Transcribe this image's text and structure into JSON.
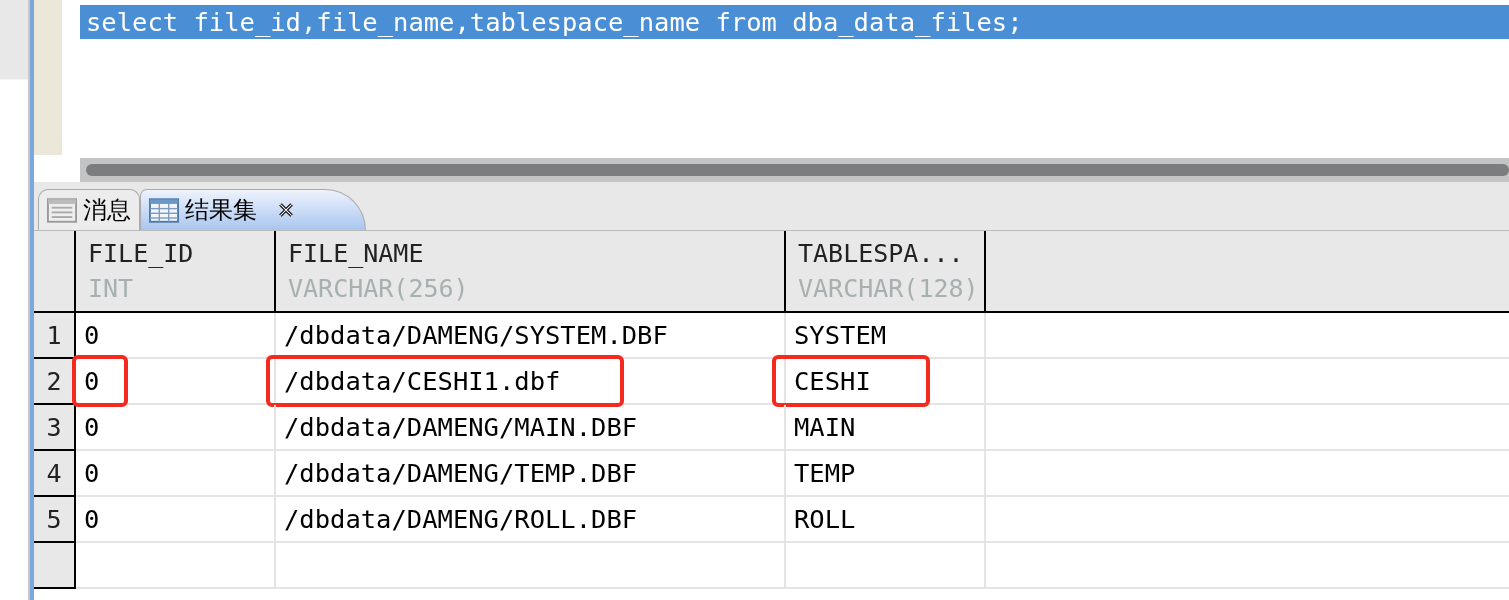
{
  "editor": {
    "query": "select file_id,file_name,tablespace_name from dba_data_files;",
    "selected": true
  },
  "tabs": [
    {
      "label": "消息",
      "selected": false,
      "closable": false
    },
    {
      "label": "结果集",
      "selected": true,
      "closable": true
    }
  ],
  "table": {
    "columns": [
      {
        "name": "FILE_ID",
        "type": "INT"
      },
      {
        "name": "FILE_NAME",
        "type": "VARCHAR(256)"
      },
      {
        "name": "TABLESPA...",
        "type": "VARCHAR(128)"
      }
    ],
    "rows": [
      {
        "number": "1",
        "cells": [
          "0",
          "/dbdata/DAMENG/SYSTEM.DBF",
          "SYSTEM"
        ],
        "highlighted": false
      },
      {
        "number": "2",
        "cells": [
          "0",
          "/dbdata/CESHI1.dbf",
          "CESHI"
        ],
        "highlighted": true
      },
      {
        "number": "3",
        "cells": [
          "0",
          "/dbdata/DAMENG/MAIN.DBF",
          "MAIN"
        ],
        "highlighted": false
      },
      {
        "number": "4",
        "cells": [
          "0",
          "/dbdata/DAMENG/TEMP.DBF",
          "TEMP"
        ],
        "highlighted": false
      },
      {
        "number": "5",
        "cells": [
          "0",
          "/dbdata/DAMENG/ROLL.DBF",
          "ROLL"
        ],
        "highlighted": false
      }
    ]
  }
}
